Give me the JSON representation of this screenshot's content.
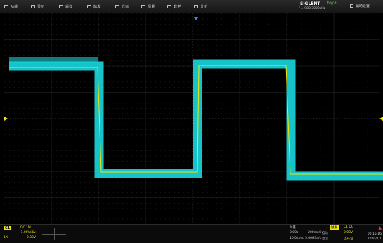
{
  "menu": {
    "items": [
      {
        "label": "功能",
        "icon": "function-icon"
      },
      {
        "label": "显示",
        "icon": "display-icon"
      },
      {
        "label": "采样",
        "icon": "acquire-icon"
      },
      {
        "label": "触发",
        "icon": "trigger-icon"
      },
      {
        "label": "光标",
        "icon": "cursor-icon"
      },
      {
        "label": "测量",
        "icon": "measure-icon"
      },
      {
        "label": "数学",
        "icon": "math-icon"
      },
      {
        "label": "分析",
        "icon": "analysis-icon"
      }
    ],
    "system_label": "辅助设置"
  },
  "brand": {
    "logo": "SIGLENT",
    "trig_state": "Trig'd",
    "frequency": "f = 980.3000kHz"
  },
  "channel": {
    "tag": "C1",
    "coupling": "DC 1M",
    "scale": "1.00V/div",
    "offset": "0.00V",
    "label2": "1X"
  },
  "timebase": {
    "title": "时基",
    "delay": "0.00s",
    "timediv": "200ns/div",
    "samplerate": "10.0kpts",
    "samplerate2": "5.00GSa/s",
    "mode_a": "自动",
    "mode_b": "边沿"
  },
  "trigger": {
    "title": "触发",
    "source": "C1 DC",
    "level": "0.00V",
    "slope": "上升沿"
  },
  "clock": {
    "time": "00:15:16",
    "date": "2020/1/1"
  },
  "colors": {
    "channel1": "#f2e40b",
    "persistence": "#16c3c9",
    "trigger_marker": "#2f88ff"
  }
}
